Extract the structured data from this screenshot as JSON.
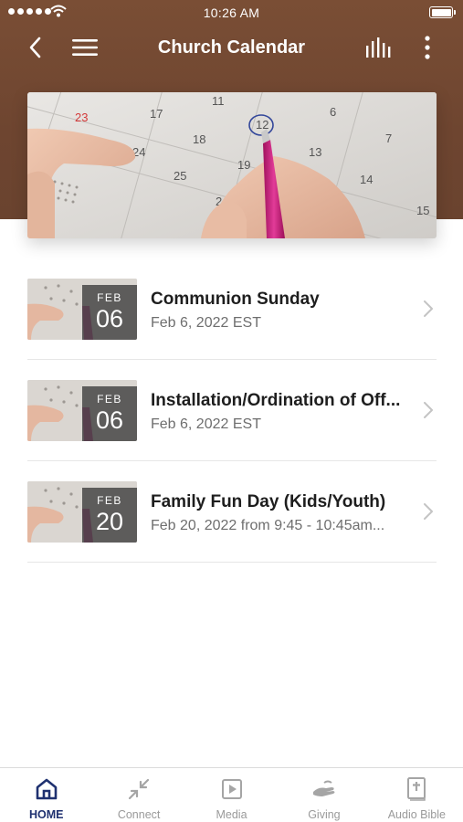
{
  "status_bar": {
    "time": "10:26 AM"
  },
  "nav": {
    "title": "Church Calendar",
    "icons": [
      "back-icon",
      "hamburger-menu-icon",
      "bar-chart-icon",
      "more-vertical-icon"
    ]
  },
  "hero": {
    "calendar_numbers": [
      "23",
      "17",
      "11",
      "12",
      "6",
      "24",
      "18",
      "13",
      "7",
      "25",
      "19",
      "14",
      "2",
      "15"
    ]
  },
  "events": [
    {
      "month": "FEB",
      "day": "06",
      "title": "Communion Sunday",
      "subtitle": "Feb 6, 2022 EST"
    },
    {
      "month": "FEB",
      "day": "06",
      "title": "Installation/Ordination of Off...",
      "subtitle": "Feb 6, 2022 EST"
    },
    {
      "month": "FEB",
      "day": "20",
      "title": "Family Fun Day (Kids/Youth)",
      "subtitle": "Feb 20, 2022 from 9:45 - 10:45am..."
    }
  ],
  "tabs": [
    {
      "label": "HOME",
      "icon": "home-icon",
      "active": true
    },
    {
      "label": "Connect",
      "icon": "connect-arrows-icon",
      "active": false
    },
    {
      "label": "Media",
      "icon": "play-icon",
      "active": false
    },
    {
      "label": "Giving",
      "icon": "giving-hand-icon",
      "active": false
    },
    {
      "label": "Audio Bible",
      "icon": "bible-icon",
      "active": false
    }
  ],
  "colors": {
    "header_brown": "#6e4530",
    "active_tab": "#1f3170",
    "inactive_tab": "#9a9a9a",
    "pen_pink": "#d8288a"
  }
}
